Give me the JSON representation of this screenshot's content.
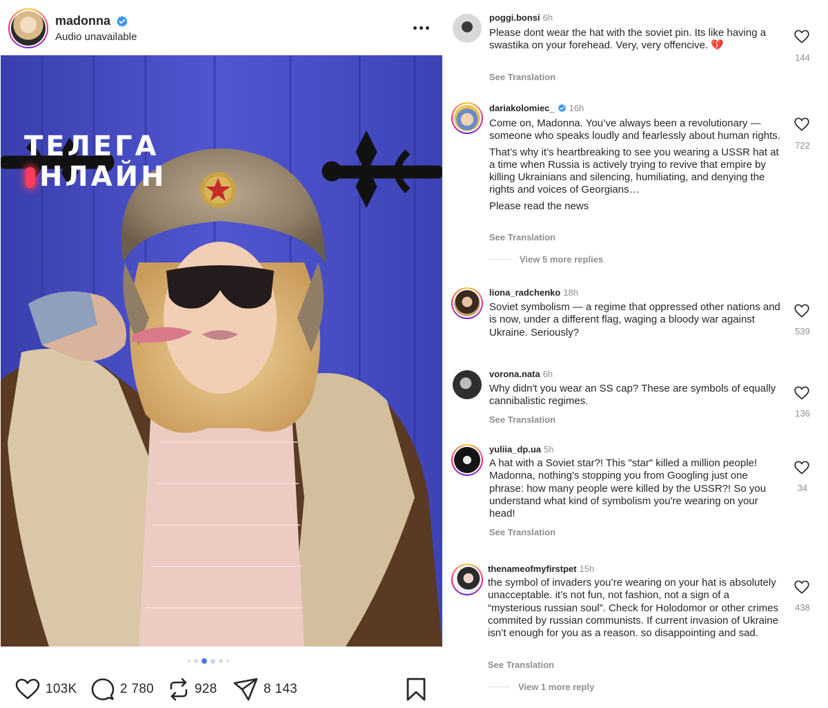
{
  "post": {
    "author": "madonna",
    "subtitle": "Audio unavailable",
    "watermark": {
      "line1": "ТЕЛЕГА",
      "line2": "НЛАЙН"
    },
    "carousel": {
      "total": 6,
      "active_index": 2
    },
    "actions": {
      "likes": "103K",
      "comments": "2 780",
      "reposts": "928",
      "shares": "8 143"
    }
  },
  "comments": [
    {
      "user": "poggi.bonsi",
      "verified": false,
      "time": "6h",
      "text": "Please dont wear the hat with the soviet pin. Its like having a swastika on your forehead. Very, very offencive. 💔",
      "see_translation": "See Translation",
      "likes": "144"
    },
    {
      "user": "dariakolomiec_",
      "verified": true,
      "time": "16h",
      "text": "Come on, Madonna. You’ve always been a revolutionary — someone who speaks loudly and fearlessly about human rights.",
      "text2": "That’s why it’s heartbreaking to see you wearing a USSR hat at a time when Russia is actively trying to revive that empire by killing Ukrainians and silencing, humiliating, and denying the rights and voices of Georgians…",
      "text3": "Please read the news",
      "see_translation": "See Translation",
      "replies": "View 5 more replies",
      "likes": "722"
    },
    {
      "user": "liona_radchenko",
      "verified": false,
      "time": "18h",
      "text": "Soviet symbolism — a regime that oppressed other nations and is now, under a different flag, waging a bloody war against Ukraine. Seriously?",
      "likes": "539"
    },
    {
      "user": "vorona.nata",
      "verified": false,
      "time": "6h",
      "text": "Why didn't you wear an SS cap? These are symbols of equally cannibalistic regimes.",
      "see_translation": "See Translation",
      "likes": "136"
    },
    {
      "user": "yuliia_dp.ua",
      "verified": false,
      "time": "5h",
      "text": "A hat with a Soviet star?! This \"star\" killed a million people! Madonna, nothing's stopping you from Googling just one phrase: how many people were killed by the USSR?! So you understand what kind of symbolism you're wearing on your head!",
      "see_translation": "See Translation",
      "likes": "34"
    },
    {
      "user": "thenameofmyfirstpet",
      "verified": false,
      "time": "15h",
      "text": "the symbol of invaders you’re wearing on your hat is absolutely unacceptable. it’s not fun, not fashion, not a sign of a “mysterious russian soul”. Check for Holodomor or other crimes commited by russian communists. If current invasion of Ukraine isn’t enough for you as a reason. so disappointing and sad.",
      "see_translation": "See Translation",
      "replies": "View 1 more reply",
      "likes": "438"
    }
  ],
  "colors": {
    "verified_blue": "#3897f0",
    "muted_text": "#8e8e8e",
    "door_blue": "#4a4fc4",
    "active_dot": "#4a79e6"
  },
  "icons": {
    "header": [
      "verified-badge-icon",
      "more-options-icon"
    ],
    "post": [
      "mute-icon",
      "heart-icon",
      "comment-icon",
      "repost-icon",
      "share-icon",
      "bookmark-icon"
    ],
    "comments": [
      "heart-icon"
    ]
  }
}
